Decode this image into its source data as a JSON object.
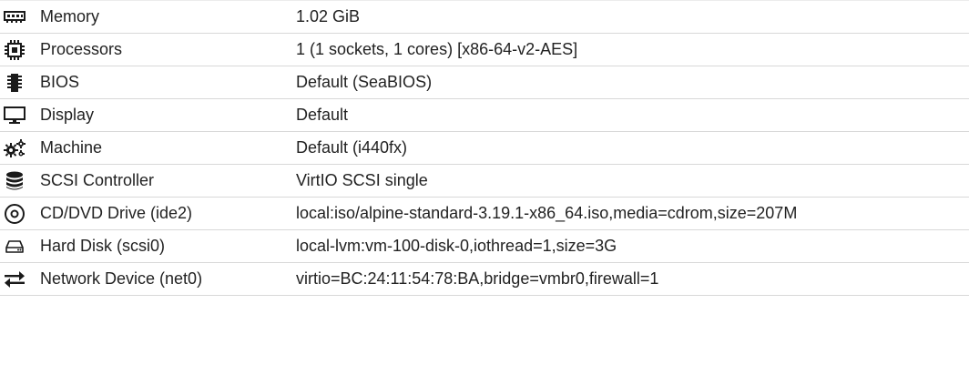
{
  "hardware": {
    "rows": [
      {
        "icon": "memory-icon",
        "key": "Memory",
        "value": "1.02 GiB"
      },
      {
        "icon": "processor-icon",
        "key": "Processors",
        "value": "1 (1 sockets, 1 cores) [x86-64-v2-AES]"
      },
      {
        "icon": "bios-chip-icon",
        "key": "BIOS",
        "value": "Default (SeaBIOS)"
      },
      {
        "icon": "monitor-icon",
        "key": "Display",
        "value": "Default"
      },
      {
        "icon": "cogs-icon",
        "key": "Machine",
        "value": "Default (i440fx)"
      },
      {
        "icon": "database-icon",
        "key": "SCSI Controller",
        "value": "VirtIO SCSI single"
      },
      {
        "icon": "cdrom-icon",
        "key": "CD/DVD Drive (ide2)",
        "value": "local:iso/alpine-standard-3.19.1-x86_64.iso,media=cdrom,size=207M"
      },
      {
        "icon": "hard-disk-icon",
        "key": "Hard Disk (scsi0)",
        "value": "local-lvm:vm-100-disk-0,iothread=1,size=3G"
      },
      {
        "icon": "network-exchange-icon",
        "key": "Network Device (net0)",
        "value": "virtio=BC:24:11:54:78:BA,bridge=vmbr0,firewall=1"
      }
    ]
  },
  "colors": {
    "text": "#222222",
    "icon": "#1a1a1a",
    "row_border": "#d8d8d8",
    "background": "#ffffff"
  }
}
